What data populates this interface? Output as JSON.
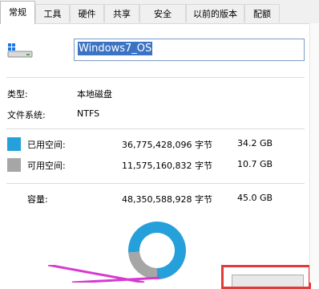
{
  "tabs": [
    {
      "label": "常规",
      "active": true
    },
    {
      "label": "工具",
      "active": false
    },
    {
      "label": "硬件",
      "active": false
    },
    {
      "label": "共享",
      "active": false
    },
    {
      "label": "安全",
      "active": false
    },
    {
      "label": "以前的版本",
      "active": false
    },
    {
      "label": "配额",
      "active": false
    }
  ],
  "drive": {
    "name": "Windows7_OS",
    "icon": "drive-icon"
  },
  "props": {
    "type_label": "类型:",
    "type_value": "本地磁盘",
    "fs_label": "文件系统:",
    "fs_value": "NTFS"
  },
  "space": {
    "used_label": "已用空间:",
    "used_bytes": "36,775,428,096 字节",
    "used_gb": "34.2 GB",
    "used_color": "#26a0da",
    "free_label": "可用空间:",
    "free_bytes": "11,575,160,832 字节",
    "free_gb": "10.7 GB",
    "free_color": "#a6a6a6",
    "cap_label": "容量:",
    "cap_bytes": "48,350,588,928 字节",
    "cap_gb": "45.0 GB"
  },
  "chart_data": {
    "type": "pie",
    "series": [
      {
        "values": [
          34.2,
          10.7
        ]
      }
    ]
  },
  "colors": {
    "accent": "#26a0da",
    "highlight": "#e03b3b",
    "arrow": "#d63ad1"
  }
}
